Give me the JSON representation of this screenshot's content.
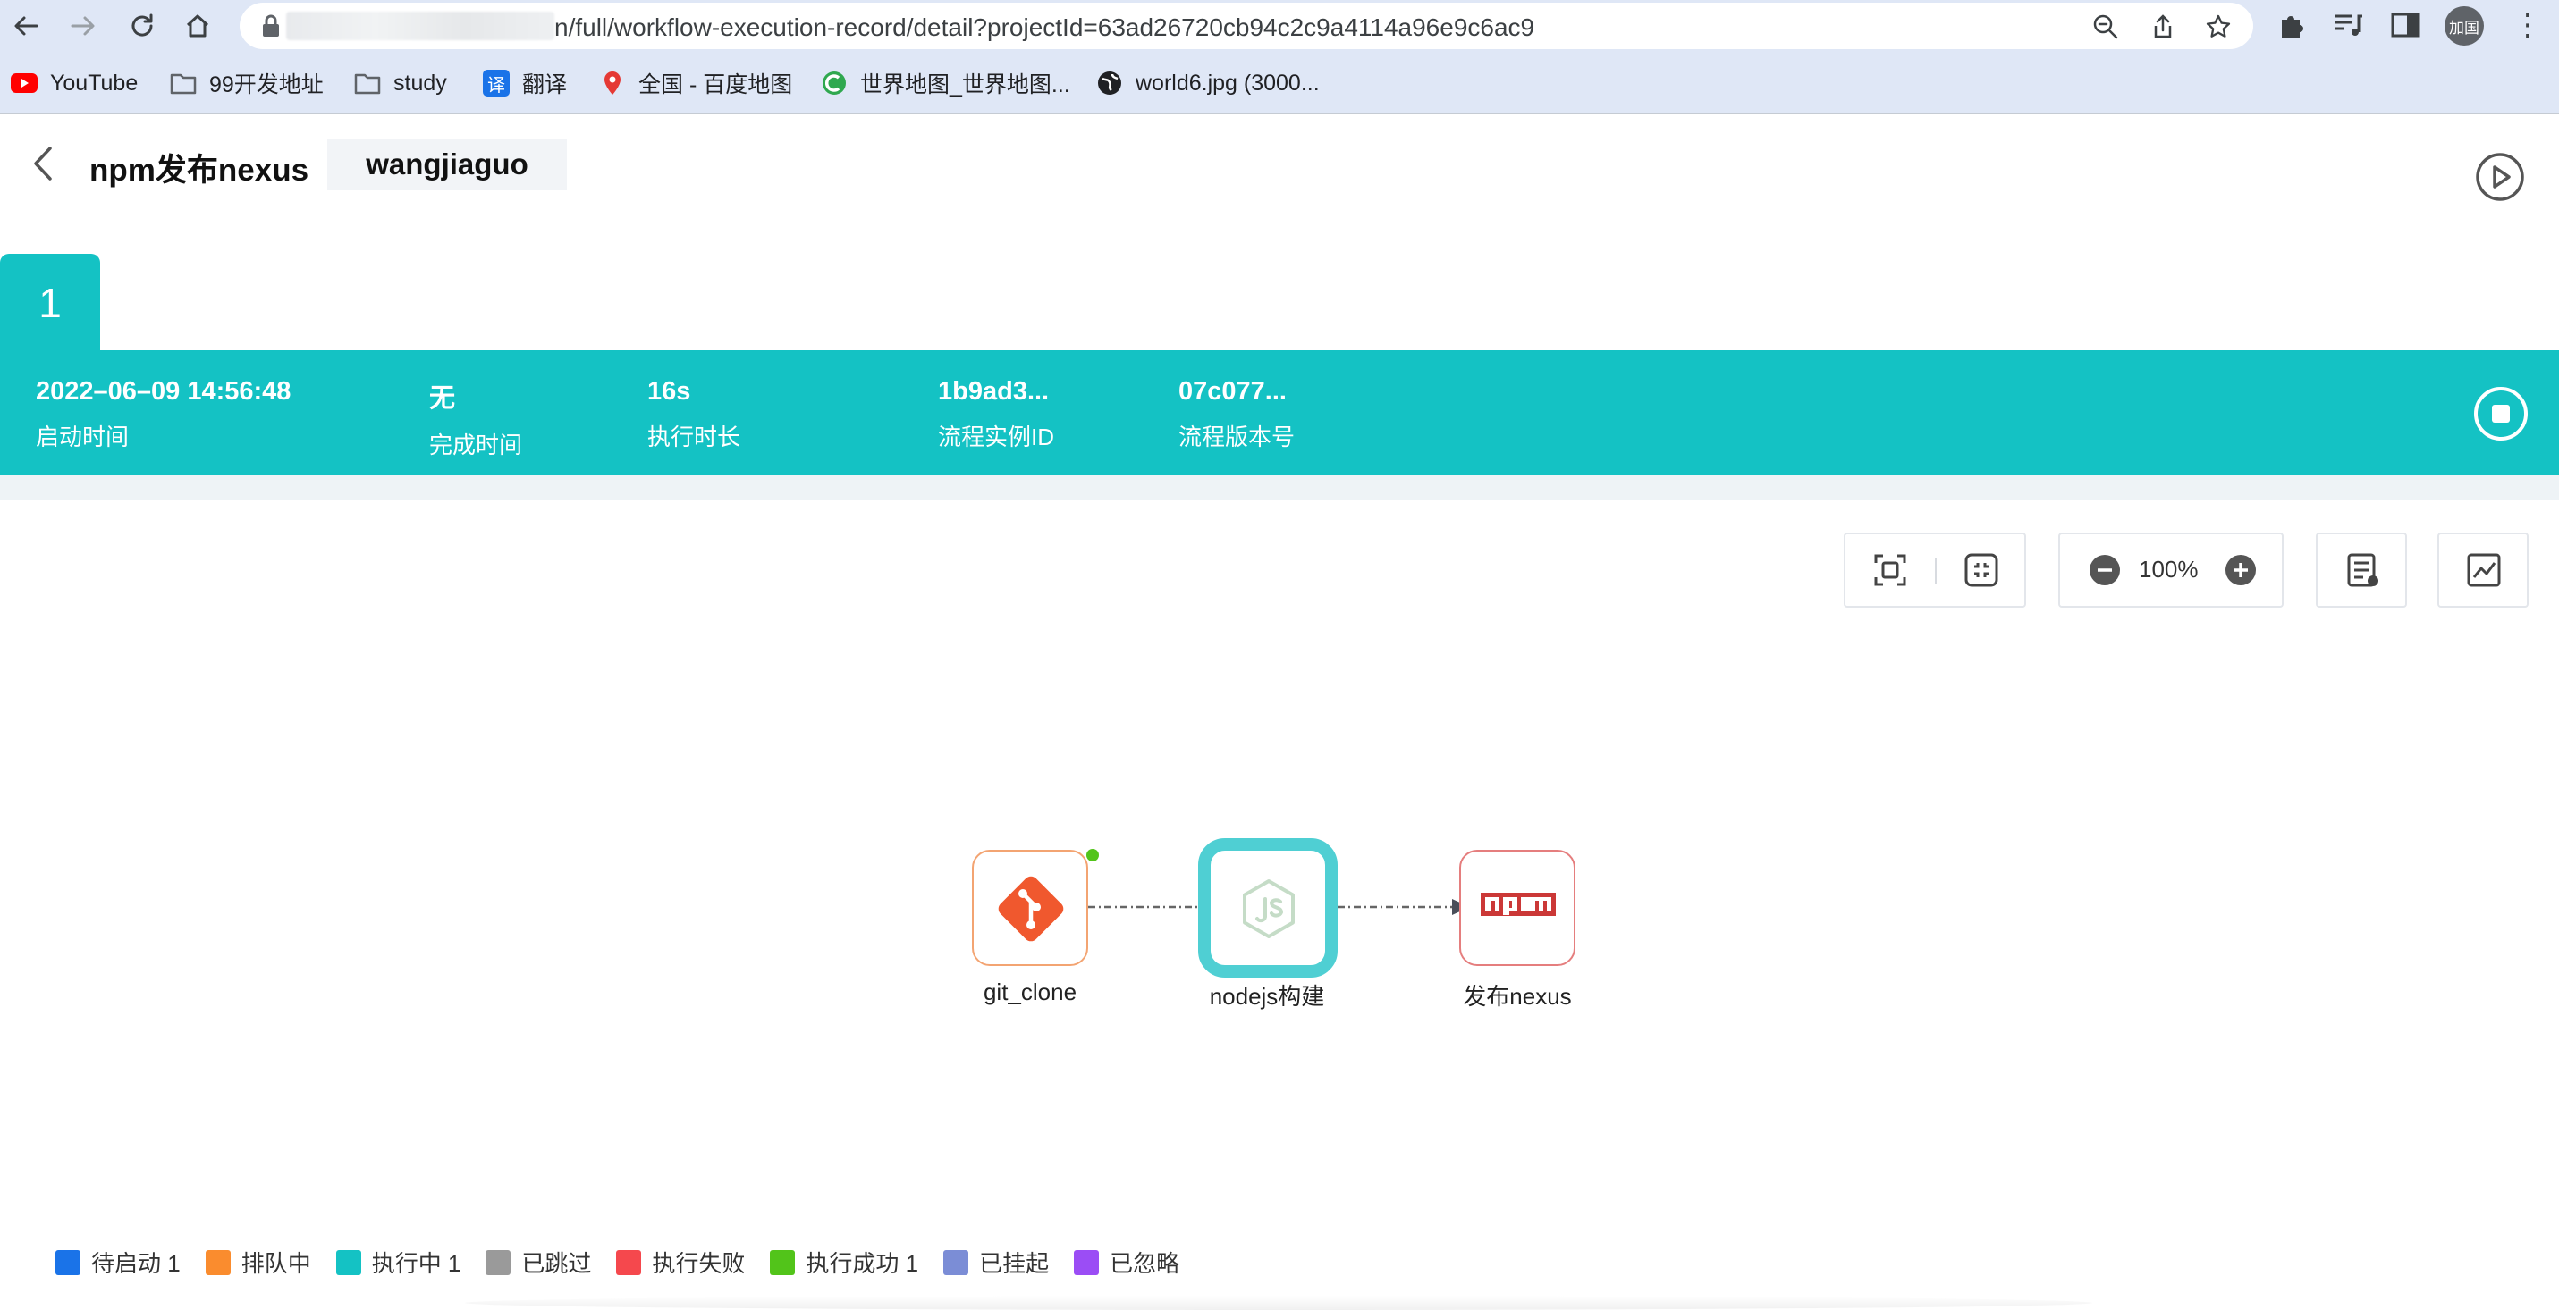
{
  "browser": {
    "url": "n/full/workflow-execution-record/detail?projectId=63ad26720cb94c2c9a4114a96e9c6ac9",
    "profile_label": "加国",
    "bookmarks": [
      {
        "label": "YouTube",
        "icon": "youtube-icon"
      },
      {
        "label": "99开发地址",
        "icon": "folder-icon"
      },
      {
        "label": "study",
        "icon": "folder-icon"
      },
      {
        "label": "翻译",
        "icon": "translate-icon",
        "icon_text": "译"
      },
      {
        "label": "全国 - 百度地图",
        "icon": "baidu-map-icon"
      },
      {
        "label": "世界地图_世界地图...",
        "icon": "world-map-icon"
      },
      {
        "label": "world6.jpg (3000...",
        "icon": "globe-icon"
      }
    ]
  },
  "header": {
    "title": "npm发布nexus",
    "user": "wangjiaguo"
  },
  "build": {
    "tab_number": "1",
    "info": [
      {
        "value": "2022–06–09 14:56:48",
        "label": "启动时间"
      },
      {
        "value": "无",
        "label": "完成时间"
      },
      {
        "value": "16s",
        "label": "执行时长"
      },
      {
        "value": "1b9ad3...",
        "label": "流程实例ID"
      },
      {
        "value": "07c077...",
        "label": "流程版本号"
      }
    ]
  },
  "toolbar": {
    "zoom": "100%"
  },
  "flow": {
    "nodes": [
      {
        "label": "git_clone",
        "icon": "git-icon",
        "status_color": "#52c41a",
        "border_color": "#f3a472"
      },
      {
        "label": "nodejs构建",
        "icon": "nodejs-icon",
        "border_color": "#14c2c4"
      },
      {
        "label": "发布nexus",
        "icon": "npm-icon",
        "border_color": "#e57e7e"
      }
    ]
  },
  "legend": [
    {
      "label": "待启动 1",
      "color": "#1a73e8"
    },
    {
      "label": "排队中",
      "color": "#fa8c2e"
    },
    {
      "label": "执行中 1",
      "color": "#14c2c4"
    },
    {
      "label": "已跳过",
      "color": "#9a9a9a"
    },
    {
      "label": "执行失败",
      "color": "#f5484d"
    },
    {
      "label": "执行成功 1",
      "color": "#52c41a"
    },
    {
      "label": "已挂起",
      "color": "#7b8dd6"
    },
    {
      "label": "已忽略",
      "color": "#9b4df5"
    }
  ]
}
